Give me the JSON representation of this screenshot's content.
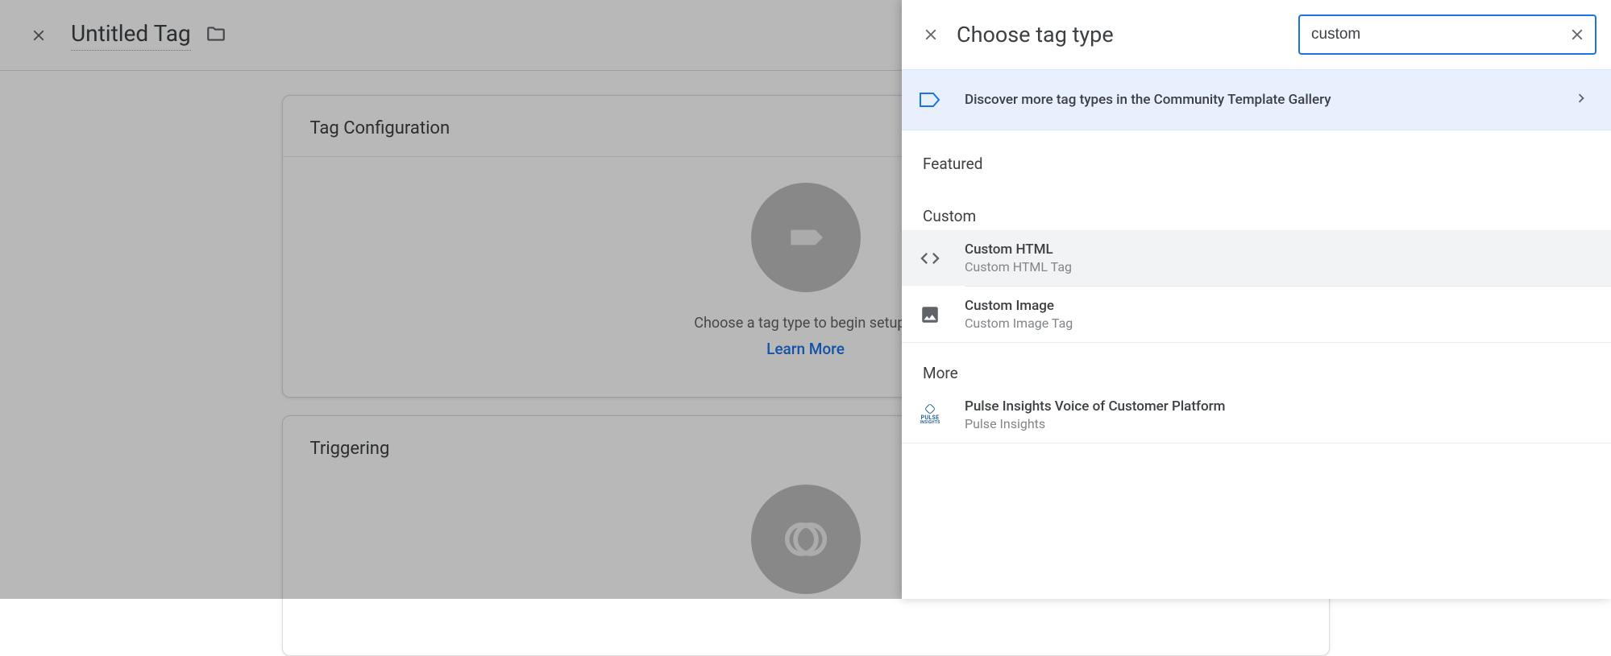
{
  "editor": {
    "tag_name": "Untitled Tag",
    "sections": {
      "config_title": "Tag Configuration",
      "config_hint": "Choose a tag type to begin setup...",
      "learn_more": "Learn More",
      "trigger_title": "Triggering"
    }
  },
  "panel": {
    "title": "Choose tag type",
    "search_value": "custom",
    "banner": "Discover more tag types in the Community Template Gallery",
    "sections": {
      "featured": "Featured",
      "custom": "Custom",
      "more": "More"
    },
    "items": {
      "custom_html": {
        "title": "Custom HTML",
        "subtitle": "Custom HTML Tag"
      },
      "custom_image": {
        "title": "Custom Image",
        "subtitle": "Custom Image Tag"
      },
      "pulse": {
        "title": "Pulse Insights Voice of Customer Platform",
        "subtitle": "Pulse Insights"
      }
    }
  }
}
